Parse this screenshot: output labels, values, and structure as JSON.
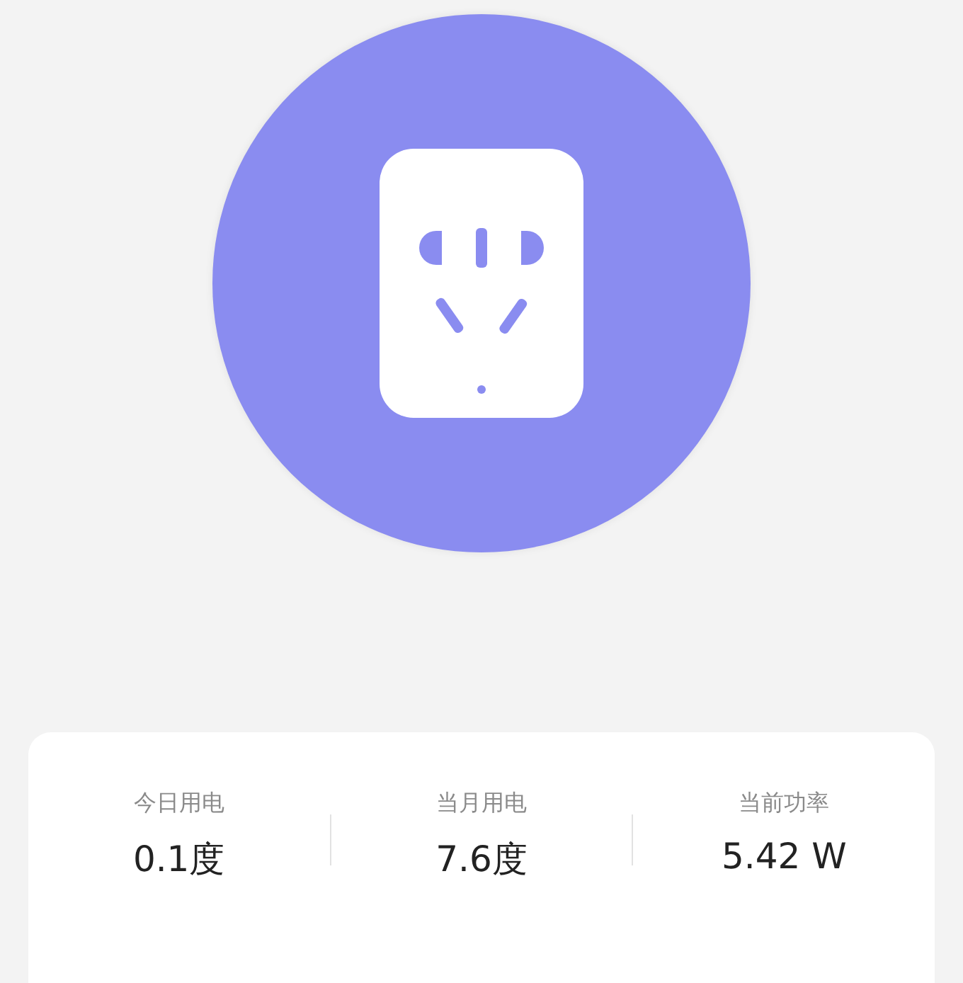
{
  "stats": [
    {
      "label": "今日用电",
      "value": "0.1度"
    },
    {
      "label": "当月用电",
      "value": "7.6度"
    },
    {
      "label": "当前功率",
      "value": "5.42 W"
    }
  ]
}
